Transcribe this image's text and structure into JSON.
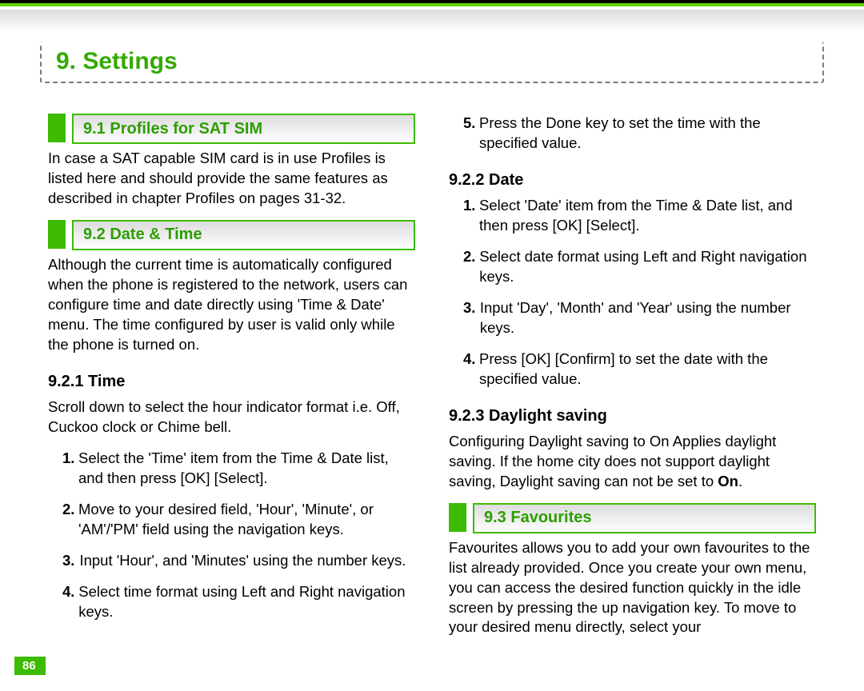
{
  "pageNumber": "86",
  "chapterTitle": "9. Settings",
  "left": {
    "sec91": {
      "title": "9.1 Profiles for SAT SIM",
      "para": "In case a SAT capable SIM card is in use Profiles is listed here and should provide the same features as described in chapter Profiles on pages 31-32."
    },
    "sec92": {
      "title": "9.2 Date & Time",
      "para": "Although the current time is automatically configured when the phone is registered to the network, users can configure time and date directly using 'Time & Date' menu. The time configured by user is valid only while the phone is turned on."
    },
    "sec921": {
      "title": "9.2.1 Time",
      "intro": "Scroll down to select the hour indicator format i.e. Off, Cuckoo clock or Chime bell.",
      "steps": [
        {
          "n": "1.",
          "t": "Select the 'Time' item from the Time & Date list, and then press [OK] [Select]."
        },
        {
          "n": "2.",
          "t": "Move to your desired field, 'Hour', 'Minute', or 'AM'/'PM' field using the navigation keys."
        },
        {
          "n": "3.",
          "t": "Input 'Hour', and 'Minutes' using the number keys."
        },
        {
          "n": "4.",
          "t": "Select time format using Left and Right navigation keys."
        }
      ]
    }
  },
  "right": {
    "step5": {
      "n": "5.",
      "t": "Press the Done key to set the time with the specified value."
    },
    "sec922": {
      "title": "9.2.2 Date",
      "steps": [
        {
          "n": "1.",
          "t": "Select 'Date' item from the Time & Date list, and then press [OK] [Select]."
        },
        {
          "n": "2.",
          "t": "Select date format using Left and Right navigation keys."
        },
        {
          "n": "3.",
          "t": "Input 'Day', 'Month' and 'Year' using the number keys."
        },
        {
          "n": "4.",
          "t": "Press [OK] [Confirm] to set the date with the specified value."
        }
      ]
    },
    "sec923": {
      "title": "9.2.3 Daylight saving",
      "para_a": "Configuring Daylight saving to On Applies daylight saving. If the home city does not support daylight saving, Daylight saving can not be set to ",
      "para_b": "On",
      "para_c": "."
    },
    "sec93": {
      "title": "9.3 Favourites",
      "para": "Favourites allows you to add your own favourites to the list already provided. Once you create your own menu, you can access the desired function quickly in the idle screen by pressing the up navigation key. To move to your desired menu directly, select your"
    }
  }
}
